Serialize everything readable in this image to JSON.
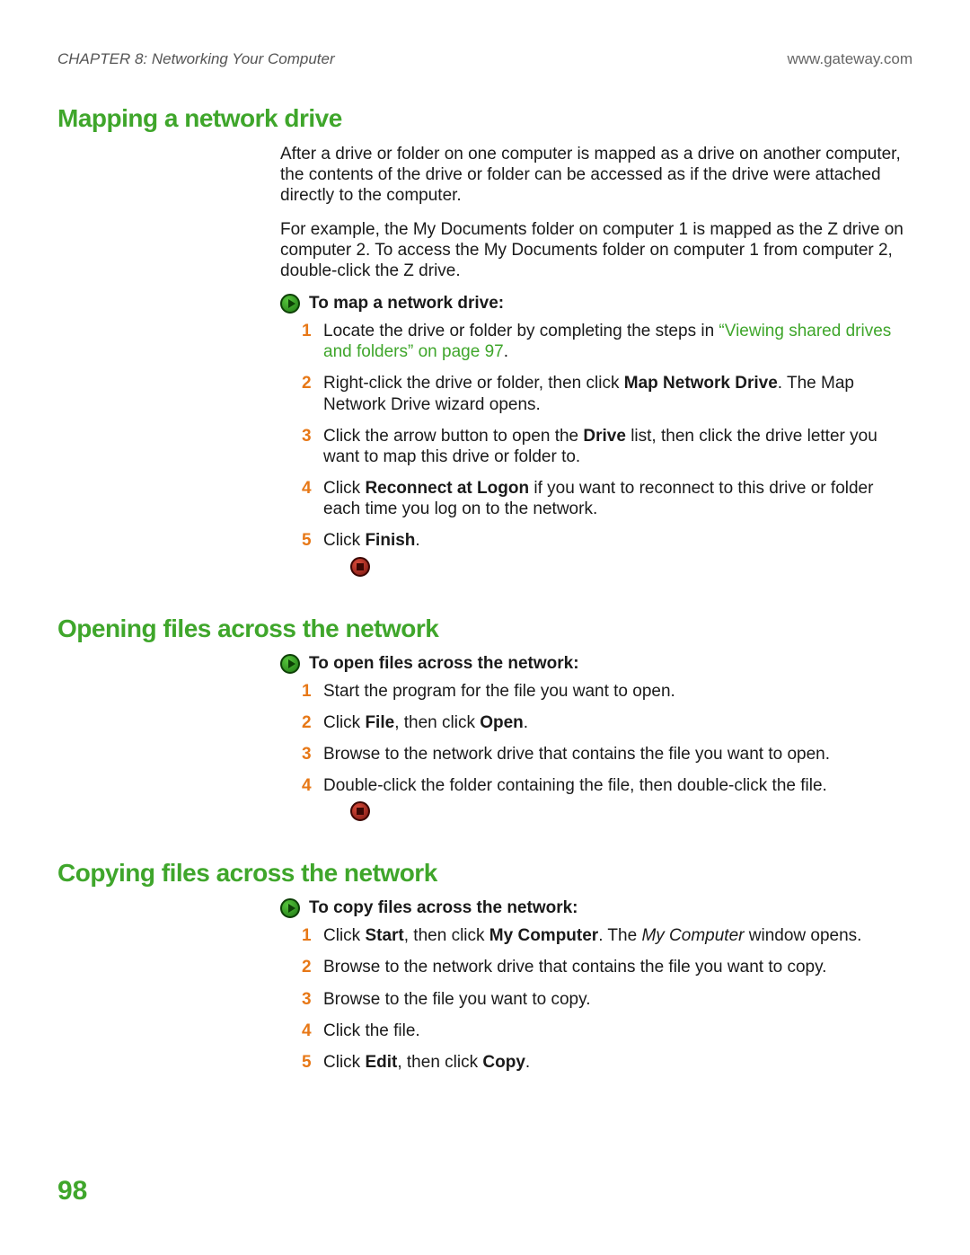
{
  "header": {
    "chapter": "CHAPTER 8: Networking Your Computer",
    "site": "www.gateway.com"
  },
  "page_number": "98",
  "sections": {
    "mapping": {
      "title": "Mapping a network drive",
      "paras": [
        "After a drive or folder on one computer is mapped as a drive on another computer, the contents of the drive or folder can be accessed as if the drive were attached directly to the computer.",
        "For example, the My Documents folder on computer 1 is mapped as the Z drive on computer 2. To access the My Documents folder on computer 1 from computer 2, double-click the Z drive."
      ],
      "proc_title": "To map a network drive:",
      "steps": {
        "s1_a": "Locate the drive or folder by completing the steps in ",
        "s1_link": "“Viewing shared drives and folders” on page 97",
        "s1_b": ".",
        "s2_a": "Right-click the drive or folder, then click ",
        "s2_bold": "Map Network Drive",
        "s2_b": ". The Map Network Drive wizard opens.",
        "s3_a": "Click the arrow button to open the ",
        "s3_bold": "Drive",
        "s3_b": " list, then click the drive letter you want to map this drive or folder to.",
        "s4_a": "Click ",
        "s4_bold": "Reconnect at Logon",
        "s4_b": " if you want to reconnect to this drive or folder each time you log on to the network.",
        "s5_a": "Click ",
        "s5_bold": "Finish",
        "s5_b": "."
      }
    },
    "opening": {
      "title": "Opening files across the network",
      "proc_title": "To open files across the network:",
      "steps": {
        "s1": "Start the program for the file you want to open.",
        "s2_a": "Click ",
        "s2_bold1": "File",
        "s2_b": ", then click ",
        "s2_bold2": "Open",
        "s2_c": ".",
        "s3": "Browse to the network drive that contains the file you want to open.",
        "s4": "Double-click the folder containing the file, then double-click the file."
      }
    },
    "copying": {
      "title": "Copying files across the network",
      "proc_title": "To copy files across the network:",
      "steps": {
        "s1_a": "Click ",
        "s1_bold1": "Start",
        "s1_b": ", then click ",
        "s1_bold2": "My Computer",
        "s1_c": ". The ",
        "s1_italic": "My Computer",
        "s1_d": " window opens.",
        "s2": "Browse to the network drive that contains the file you want to copy.",
        "s3": "Browse to the file you want to copy.",
        "s4": "Click the file.",
        "s5_a": "Click ",
        "s5_bold1": "Edit",
        "s5_b": ", then click ",
        "s5_bold2": "Copy",
        "s5_c": "."
      }
    }
  }
}
